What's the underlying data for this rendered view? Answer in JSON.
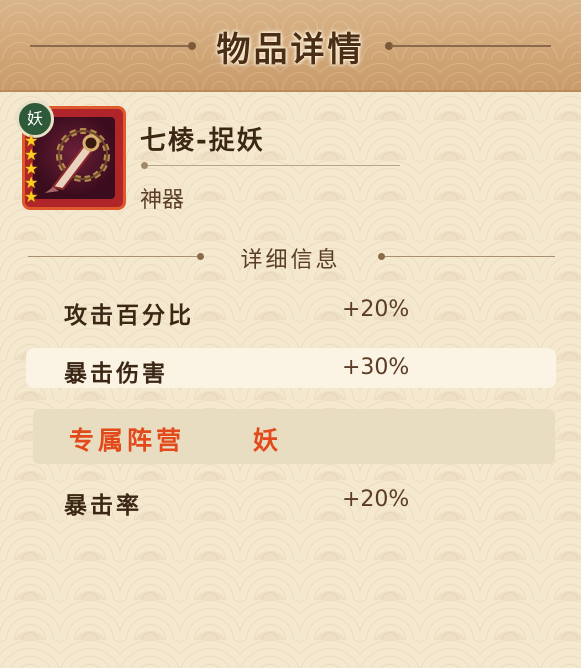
{
  "header": {
    "title": "物品详情"
  },
  "item": {
    "badge": "妖",
    "stars": 5,
    "name": "七棱-捉妖",
    "type": "神器"
  },
  "section": {
    "title": "详细信息"
  },
  "attributes": [
    {
      "name": "攻击百分比",
      "value": "+20%"
    },
    {
      "name": "暴击伤害",
      "value": "+30%"
    }
  ],
  "faction": {
    "label": "专属阵营",
    "value": "妖"
  },
  "exclusive_attributes": [
    {
      "name": "暴击率",
      "value": "+20%"
    }
  ],
  "colors": {
    "accent_orange": "#e24a1c",
    "header_bg": "#c99b6a",
    "text_brown": "#3b2714"
  }
}
